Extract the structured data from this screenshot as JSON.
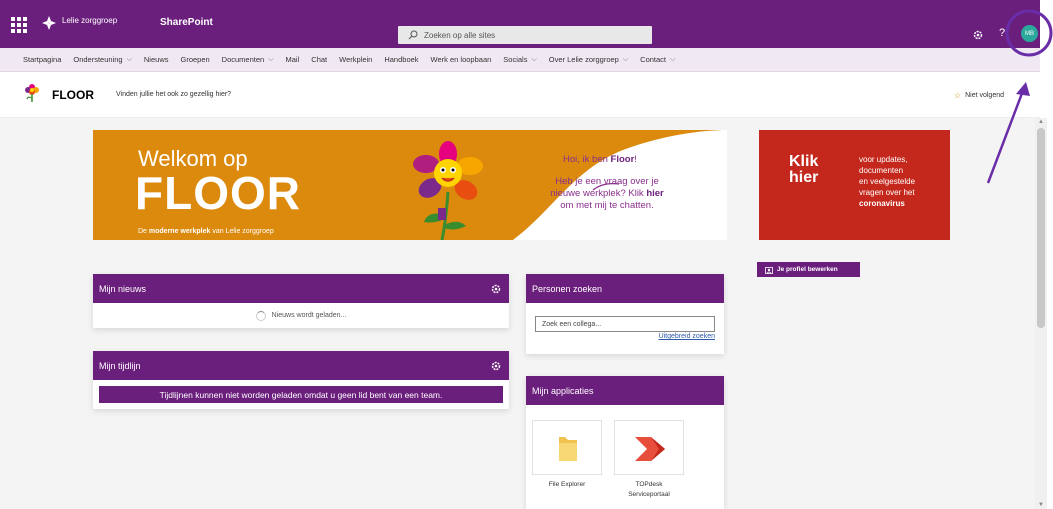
{
  "suitebar": {
    "brand_name": "Lelie zorggroep",
    "app_name": "SharePoint",
    "search_placeholder": "Zoeken op alle sites",
    "avatar_initials": "MB",
    "help_label": "?",
    "bg_color": "#6b1f7c"
  },
  "topnav": {
    "items": [
      {
        "label": "Startpagina",
        "has_menu": false
      },
      {
        "label": "Ondersteuning",
        "has_menu": true
      },
      {
        "label": "Nieuws",
        "has_menu": false
      },
      {
        "label": "Groepen",
        "has_menu": false
      },
      {
        "label": "Documenten",
        "has_menu": true
      },
      {
        "label": "Mail",
        "has_menu": false
      },
      {
        "label": "Chat",
        "has_menu": false
      },
      {
        "label": "Werkplein",
        "has_menu": false
      },
      {
        "label": "Handboek",
        "has_menu": false
      },
      {
        "label": "Werk en loopbaan",
        "has_menu": false
      },
      {
        "label": "Socials",
        "has_menu": true
      },
      {
        "label": "Over Lelie zorggroep",
        "has_menu": true
      },
      {
        "label": "Contact",
        "has_menu": true
      }
    ]
  },
  "site": {
    "title": "FLOOR",
    "description": "Vinden jullie het ook zo gezellig hier?",
    "follow_label": "Niet volgend"
  },
  "hero": {
    "welkom": "Welkom op",
    "floor": "FLOOR",
    "sub_prefix": "De ",
    "sub_bold": "moderne werkplek",
    "sub_suffix": " van Lelie zorggroep",
    "hoi_prefix": "Hoi, ik ben ",
    "hoi_bold": "Floor",
    "hoi_suffix": "!",
    "vraag_line1": "Heb je een vraag over je",
    "vraag_line2_prefix": "nieuwe werkplek? Klik ",
    "vraag_line2_bold": "hier",
    "vraag_line3": "om met mij te chatten."
  },
  "redbanner": {
    "klik": "Klik",
    "hier": "hier",
    "line1": "voor updates,",
    "line2": "documenten",
    "line3": "en veelgestelde",
    "line4": "vragen over het",
    "line5": "coronavirus"
  },
  "profile_button": {
    "label": "Je profiel bewerken"
  },
  "news": {
    "title": "Mijn nieuws",
    "loading": "Nieuws wordt geladen..."
  },
  "timeline": {
    "title": "Mijn tijdlijn",
    "message": "Tijdlijnen kunnen niet worden geladen omdat u geen lid bent van een team."
  },
  "people": {
    "title": "Personen zoeken",
    "placeholder": "Zoek een collega...",
    "advanced_link": "Uitgebreid zoeken"
  },
  "apps": {
    "title": "Mijn applicaties",
    "items": [
      {
        "label": "File Explorer",
        "icon": "folder-icon"
      },
      {
        "label": "TOPdesk Serviceportaal",
        "icon": "topdesk-icon"
      }
    ]
  },
  "colors": {
    "purple": "#6b1f7c",
    "orange": "#dc8a0e",
    "red": "#c4281c",
    "avatar": "#2ba89c",
    "annotation": "#6a2da8"
  }
}
